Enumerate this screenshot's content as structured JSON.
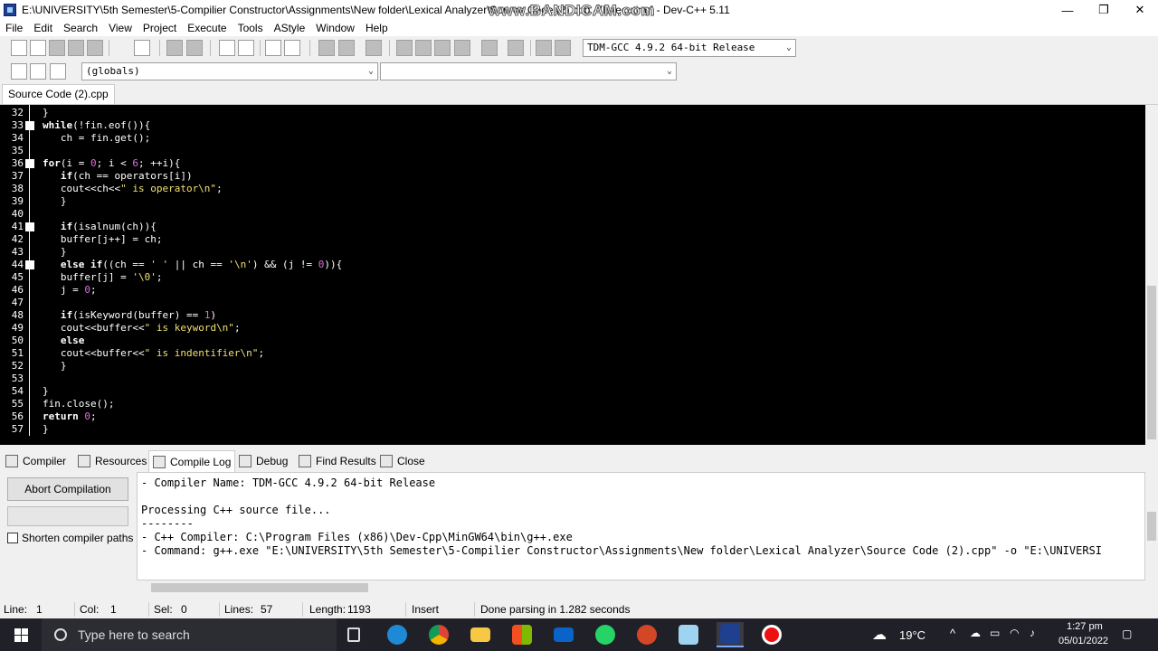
{
  "window": {
    "title": "E:\\UNIVERSITY\\5th Semester\\5-Compilier Constructor\\Assignments\\New folder\\Lexical Analyzer\\Source Code (2).cpp - [Executing] - Dev-C++ 5.11",
    "watermark": "www.BANDICAM.com",
    "minimize": "—",
    "maximize": "❐",
    "close": "✕"
  },
  "menu": [
    "File",
    "Edit",
    "Search",
    "View",
    "Project",
    "Execute",
    "Tools",
    "AStyle",
    "Window",
    "Help"
  ],
  "toolbar": {
    "compiler_select": "TDM-GCC 4.9.2 64-bit Release",
    "scope_select": "(globals)",
    "member_select": ""
  },
  "file_tab": "Source Code (2).cpp",
  "editor": {
    "lines": [
      {
        "n": "32",
        "fold": false,
        "text": "}"
      },
      {
        "n": "33",
        "fold": true,
        "text": "while(!fin.eof()){"
      },
      {
        "n": "34",
        "fold": false,
        "text": "   ch = fin.get();"
      },
      {
        "n": "35",
        "fold": false,
        "text": ""
      },
      {
        "n": "36",
        "fold": true,
        "text": "for(i = 0; i < 6; ++i){"
      },
      {
        "n": "37",
        "fold": false,
        "text": "   if(ch == operators[i])"
      },
      {
        "n": "38",
        "fold": false,
        "text": "   cout<<ch<<\" is operator\\n\";"
      },
      {
        "n": "39",
        "fold": false,
        "text": "   }"
      },
      {
        "n": "40",
        "fold": false,
        "text": ""
      },
      {
        "n": "41",
        "fold": true,
        "text": "   if(isalnum(ch)){"
      },
      {
        "n": "42",
        "fold": false,
        "text": "   buffer[j++] = ch;"
      },
      {
        "n": "43",
        "fold": false,
        "text": "   }"
      },
      {
        "n": "44",
        "fold": true,
        "text": "   else if((ch == ' ' || ch == '\\n') && (j != 0)){"
      },
      {
        "n": "45",
        "fold": false,
        "text": "   buffer[j] = '\\0';"
      },
      {
        "n": "46",
        "fold": false,
        "text": "   j = 0;"
      },
      {
        "n": "47",
        "fold": false,
        "text": ""
      },
      {
        "n": "48",
        "fold": false,
        "text": "   if(isKeyword(buffer) == 1)"
      },
      {
        "n": "49",
        "fold": false,
        "text": "   cout<<buffer<<\" is keyword\\n\";"
      },
      {
        "n": "50",
        "fold": false,
        "text": "   else"
      },
      {
        "n": "51",
        "fold": false,
        "text": "   cout<<buffer<<\" is indentifier\\n\";"
      },
      {
        "n": "52",
        "fold": false,
        "text": "   }"
      },
      {
        "n": "53",
        "fold": false,
        "text": ""
      },
      {
        "n": "54",
        "fold": false,
        "text": "}"
      },
      {
        "n": "55",
        "fold": false,
        "text": "fin.close();"
      },
      {
        "n": "56",
        "fold": false,
        "text": "return 0;"
      },
      {
        "n": "57",
        "fold": false,
        "text": "}"
      }
    ]
  },
  "bottom_tabs": [
    "Compiler",
    "Resources",
    "Compile Log",
    "Debug",
    "Find Results",
    "Close"
  ],
  "left_panel": {
    "abort_button": "Abort Compilation",
    "shorten_label": "Shorten compiler paths"
  },
  "log": [
    "- Compiler Name: TDM-GCC 4.9.2 64-bit Release",
    "",
    "Processing C++ source file...",
    "--------",
    "- C++ Compiler: C:\\Program Files (x86)\\Dev-Cpp\\MinGW64\\bin\\g++.exe",
    "- Command: g++.exe \"E:\\UNIVERSITY\\5th Semester\\5-Compilier Constructor\\Assignments\\New folder\\Lexical Analyzer\\Source Code (2).cpp\" -o \"E:\\UNIVERSI"
  ],
  "status": {
    "line_label": "Line:",
    "line_val": "1",
    "col_label": "Col:",
    "col_val": "1",
    "sel_label": "Sel:",
    "sel_val": "0",
    "lines_label": "Lines:",
    "lines_val": "57",
    "length_label": "Length:",
    "length_val": "1193",
    "mode": "Insert",
    "message": "Done parsing in 1.282 seconds"
  },
  "taskbar": {
    "search_placeholder": "Type here to search",
    "weather": "19°C",
    "time": "1:27 pm",
    "date": "05/01/2022"
  }
}
